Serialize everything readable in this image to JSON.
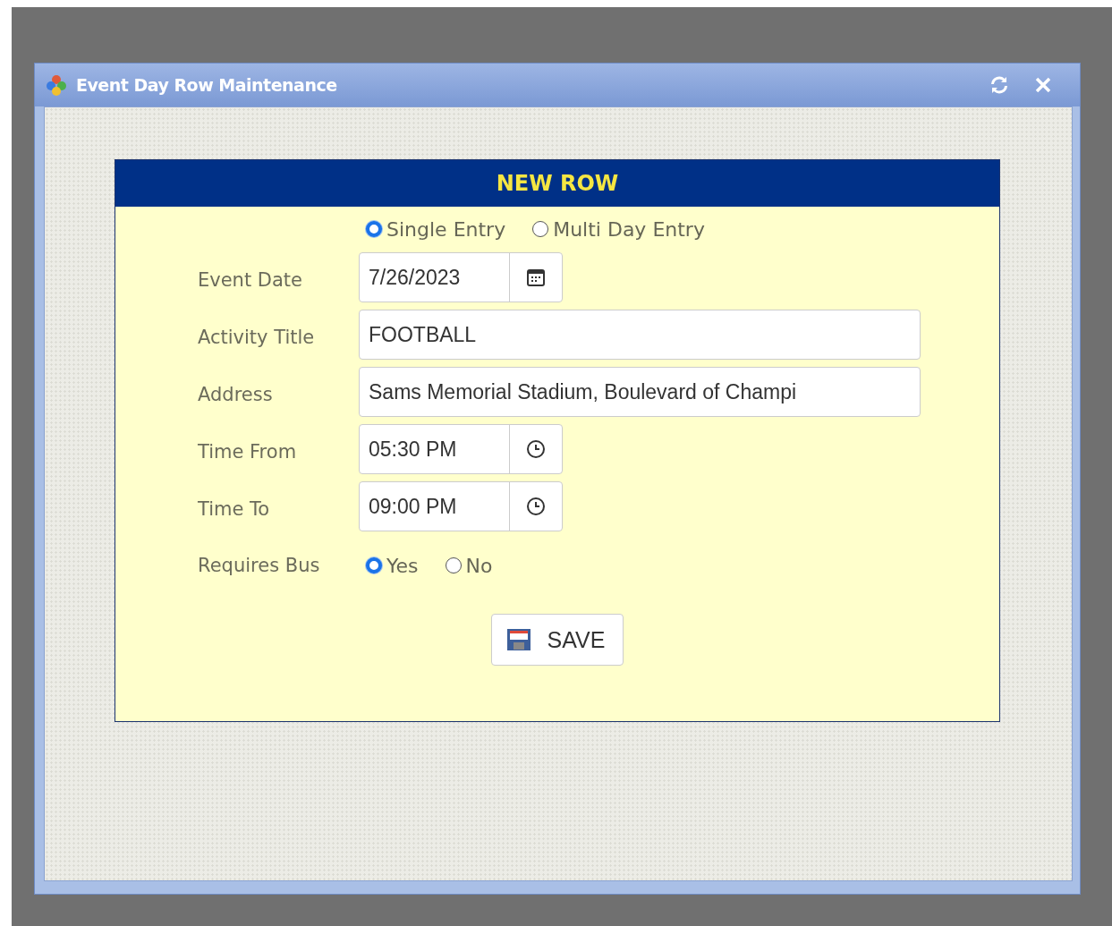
{
  "window": {
    "title": "Event Day Row Maintenance"
  },
  "form": {
    "heading": "NEW ROW",
    "entry_mode": [
      {
        "label": "Single Entry",
        "selected": true
      },
      {
        "label": "Multi Day Entry",
        "selected": false
      }
    ],
    "fields": [
      {
        "kind": "date",
        "label": "Event Date",
        "value": "7/26/2023"
      },
      {
        "kind": "text",
        "label": "Activity Title",
        "value": "FOOTBALL"
      },
      {
        "kind": "text",
        "label": "Address",
        "value": "Sams Memorial Stadium, Boulevard of Champi"
      },
      {
        "kind": "time",
        "label": "Time From",
        "value": "05:30 PM"
      },
      {
        "kind": "time",
        "label": "Time To",
        "value": "09:00 PM"
      }
    ],
    "requires_bus": {
      "label": "Requires Bus",
      "options": [
        {
          "label": "Yes",
          "selected": true
        },
        {
          "label": "No",
          "selected": false
        }
      ]
    },
    "save_button": "SAVE"
  }
}
